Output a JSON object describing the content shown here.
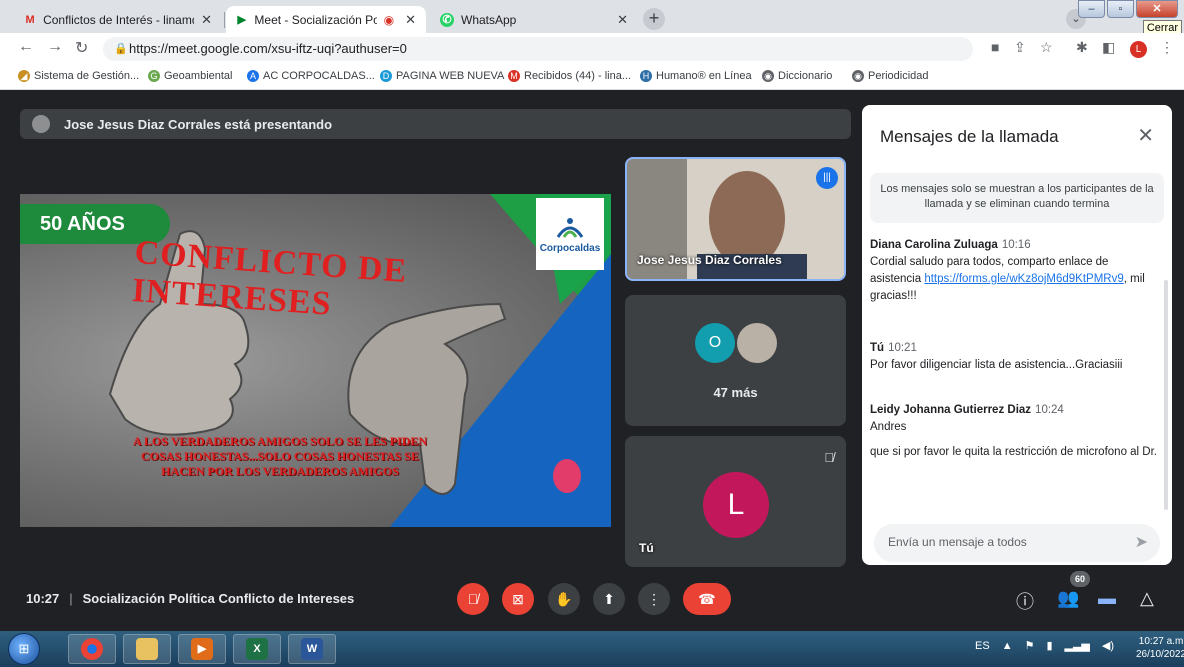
{
  "browser": {
    "tabs": [
      {
        "title": "Conflictos de Interés - linamdaza",
        "icon": "gmail-icon"
      },
      {
        "title": "Meet - Socialización Política",
        "icon": "meet-icon"
      },
      {
        "title": "WhatsApp",
        "icon": "whatsapp-icon"
      }
    ],
    "tooltip": "Cerrar",
    "url": "https://meet.google.com/xsu-iftz-uqi?authuser=0",
    "profile_letter": "L",
    "bookmarks": [
      "Sistema de Gestión...",
      "Geoambiental",
      "AC CORPOCALDAS...",
      "PAGINA WEB NUEVA",
      "Recibidos (44) - lina...",
      "Humano® en Línea",
      "Diccionario",
      "Periodicidad"
    ]
  },
  "meet": {
    "presenting_banner": "Jose Jesus Diaz Corrales está presentando",
    "slide": {
      "badge": "50 AÑOS",
      "title": "CONFLICTO DE INTERESES",
      "logo_text": "Corpocaldas",
      "quote": "A LOS VERDADEROS AMIGOS SOLO SE LES PIDEN COSAS HONESTAS...SOLO COSAS HONESTAS SE HACEN POR LOS VERDADEROS AMIGOS"
    },
    "tiles": {
      "presenter_name": "Jose Jesus Diaz Corrales",
      "group_avatar_letter": "O",
      "more_label": "47 más",
      "self_avatar_letter": "L",
      "self_label": "Tú"
    },
    "chat": {
      "title": "Mensajes de la llamada",
      "info": "Los mensajes solo se muestran a los participantes de la llamada y se eliminan cuando termina",
      "messages": [
        {
          "sender": "Diana Carolina Zuluaga",
          "time": "10:16",
          "text_before": "Cordial saludo para todos, comparto enlace de asistencia ",
          "link": "https://forms.gle/wKz8ojM6d9KtPMRv9",
          "text_after": ", mil gracias!!!"
        },
        {
          "sender": "Tú",
          "time": "10:21",
          "text": "Por favor diligenciar lista de asistencia...Graciasiii"
        },
        {
          "sender": "Leidy Johanna Gutierrez Diaz",
          "time": "10:24",
          "text": "Andres",
          "text2": "que si por favor le quita la restricción de microfono al Dr."
        }
      ],
      "input_placeholder": "Envía un mensaje a todos"
    },
    "bottom": {
      "time": "10:27",
      "meeting_title": "Socialización Política Conflicto de Intereses",
      "people_count": "60"
    }
  },
  "taskbar": {
    "language": "ES",
    "time": "10:27 a.m.",
    "date": "26/10/2022"
  }
}
